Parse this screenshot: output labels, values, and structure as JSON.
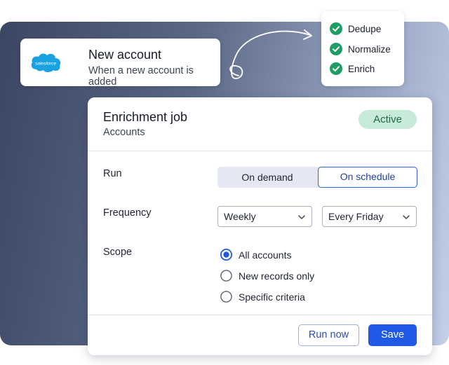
{
  "colors": {
    "accent": "#1f5ae6",
    "success": "#1e9e63",
    "badge_bg": "#c8ead8",
    "salesforce": "#1aa2e0"
  },
  "trigger": {
    "logo_text": "salesforce",
    "logo_icon": "salesforce-cloud-icon",
    "title": "New account",
    "subtitle": "When a new account is added"
  },
  "checklist": {
    "items": [
      {
        "label": "Dedupe",
        "icon": "check-circle-icon"
      },
      {
        "label": "Normalize",
        "icon": "check-circle-icon"
      },
      {
        "label": "Enrich",
        "icon": "check-circle-icon"
      }
    ]
  },
  "job": {
    "title": "Enrichment job",
    "subtitle": "Accounts",
    "status": "Active",
    "run": {
      "label": "Run",
      "options": [
        "On demand",
        "On schedule"
      ],
      "selected": "On schedule"
    },
    "frequency": {
      "label": "Frequency",
      "interval": "Weekly",
      "day": "Every Friday"
    },
    "scope": {
      "label": "Scope",
      "options": [
        "All accounts",
        "New records only",
        "Specific criteria"
      ],
      "selected": "All accounts"
    },
    "actions": {
      "run_now": "Run now",
      "save": "Save"
    }
  }
}
